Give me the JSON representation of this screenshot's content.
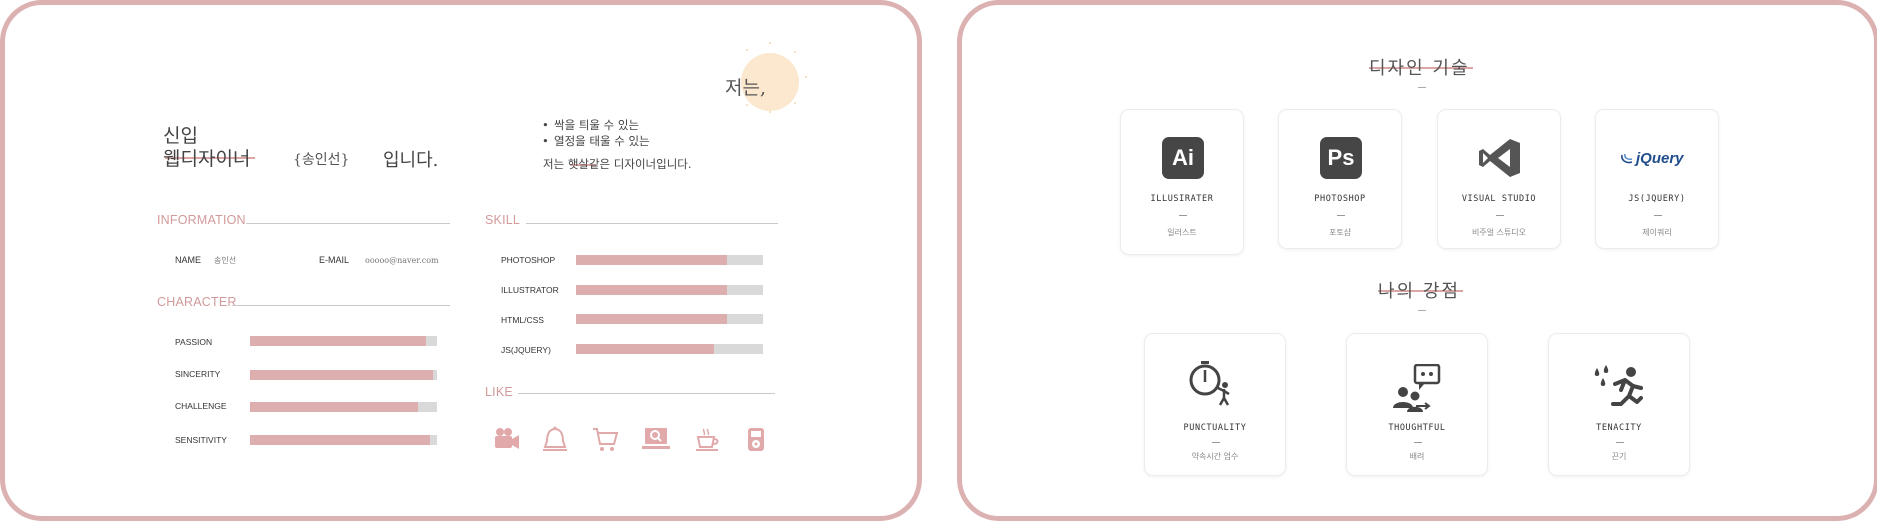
{
  "intro": {
    "label": "저는,",
    "line1": "신입",
    "line2": "웹디자이너",
    "name": "{송인선}",
    "line_end": "입니다.",
    "bullets": [
      "싹을 틔울 수 있는",
      "열정을 태울 수 있는"
    ],
    "summary": "저는 햇살같은  디자이너입니다."
  },
  "information": {
    "title": "INFORMATION",
    "name_key": "NAME",
    "name_value": "송인선",
    "email_key": "E-MAIL",
    "email_value": "ooooo@naver.com"
  },
  "character": {
    "title": "CHARACTER",
    "items": [
      {
        "label": "PASSION",
        "value": 0.94
      },
      {
        "label": "SINCERITY",
        "value": 0.98
      },
      {
        "label": "CHALLENGE",
        "value": 0.9
      },
      {
        "label": "SENSITIVITY",
        "value": 0.96
      }
    ]
  },
  "skill": {
    "title": "SKILL",
    "items": [
      {
        "label": "PHOTOSHOP",
        "value": 0.81
      },
      {
        "label": "ILLUSTRATOR",
        "value": 0.81
      },
      {
        "label": "HTML/CSS",
        "value": 0.81
      },
      {
        "label": "JS(JQUERY)",
        "value": 0.74
      }
    ]
  },
  "like": {
    "title": "LIKE",
    "icons": [
      "video-camera-icon",
      "bell-icon",
      "shopping-cart-icon",
      "laptop-search-icon",
      "coffee-cup-icon",
      "music-player-icon"
    ]
  },
  "design_skills": {
    "title": "디자인 기술",
    "cards": [
      {
        "icon": "illustrator-logo-icon",
        "logo": "Ai",
        "name": "ILLUSIRATER",
        "sub": "일러스트"
      },
      {
        "icon": "photoshop-logo-icon",
        "logo": "Ps",
        "name": "PHOTOSHOP",
        "sub": "포토샵"
      },
      {
        "icon": "visual-studio-logo-icon",
        "name": "VISUAL STUDIO",
        "sub": "비주얼 스튜디오"
      },
      {
        "icon": "jquery-logo-icon",
        "logo": "jQuery",
        "name": "JS(JQUERY)",
        "sub": "제이쿼리"
      }
    ]
  },
  "strengths": {
    "title": "나의 강점",
    "cards": [
      {
        "icon": "stopwatch-person-icon",
        "name": "PUNCTUALITY",
        "sub": "약속시간 엄수"
      },
      {
        "icon": "conversation-icon",
        "name": "THOUGHTFUL",
        "sub": "배려"
      },
      {
        "icon": "running-person-icon",
        "name": "TENACITY",
        "sub": "끈기"
      }
    ]
  },
  "colors": {
    "accent": "#dcb1b1",
    "bar_fill": "#dcaeae",
    "bar_track": "#d9d9d9",
    "sun": "#fce8cf",
    "logo_dark": "#464646",
    "jquery_blue": "#1f4d8c"
  }
}
